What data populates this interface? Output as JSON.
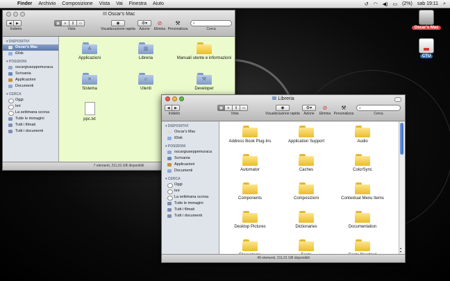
{
  "menubar": {
    "items": [
      "Finder",
      "Archivio",
      "Composizione",
      "Vista",
      "Vai",
      "Finestra",
      "Aiuto"
    ],
    "battery": "(2%)",
    "clock": "sab 19:11"
  },
  "desktop_icons": [
    {
      "label": "Oscar's Mac",
      "icon": "hard-drive-icon"
    },
    {
      "label": "CTU",
      "icon": "network-volume-icon"
    }
  ],
  "toolbar": {
    "back_forward_label": "Indietro",
    "view_label": "Vista",
    "quicklook_label": "Visualizzazione rapida",
    "action_label": "Azione",
    "delete_label": "Elimina",
    "customize_label": "Personalizza",
    "search_label": "Cerca"
  },
  "sidebar": {
    "sections": [
      {
        "heading": "DISPOSITIVI",
        "items": [
          "Oscar's Mac",
          "iDisk"
        ]
      },
      {
        "heading": "POSIZIONI",
        "items": [
          "oscargiuseppemuraca",
          "Scrivania",
          "Applicazioni",
          "Documenti"
        ]
      },
      {
        "heading": "CERCA",
        "items": [
          "Oggi",
          "Ieri",
          "La settimana scorsa",
          "Tutte le immagini",
          "Tutti i filmati",
          "Tutti i documenti"
        ]
      }
    ]
  },
  "window_back": {
    "title": "Oscar's Mac",
    "selected_sidebar": "Oscar's Mac",
    "status": "7 elementi, 211,01 GB disponibili",
    "items": [
      {
        "label": "Applicazioni",
        "kind": "blue-folder",
        "emblem": "A"
      },
      {
        "label": "Libreria",
        "kind": "blue-folder",
        "emblem": "▥"
      },
      {
        "label": "Manuali utente e informazioni",
        "kind": "yellow-folder",
        "emblem": ""
      },
      {
        "label": "Sistema",
        "kind": "blue-folder",
        "emblem": "✕"
      },
      {
        "label": "Utenti",
        "kind": "blue-folder",
        "emblem": "☺"
      },
      {
        "label": "Developer",
        "kind": "blue-folder",
        "emblem": "⚒"
      },
      {
        "label": "ppc.txt",
        "kind": "document",
        "emblem": ""
      }
    ]
  },
  "window_front": {
    "title": "Libreria",
    "status": "49 elementi, 211,01 GB disponibili",
    "items": [
      "Address Book Plug-Ins",
      "Application Support",
      "Audio",
      "Automator",
      "Caches",
      "ColorSync",
      "Components",
      "Composizioni",
      "Contextual Menu Items",
      "Desktop Pictures",
      "Dictionaries",
      "Documentation",
      "Filesystems",
      "Fonts",
      "Fonts Disabled"
    ]
  },
  "colors": {
    "back_window_bg": "#ecfbcc",
    "selection": "#5d78ab",
    "folder_yellow": "#e9bd2e",
    "folder_blue": "#7f9bc6"
  }
}
